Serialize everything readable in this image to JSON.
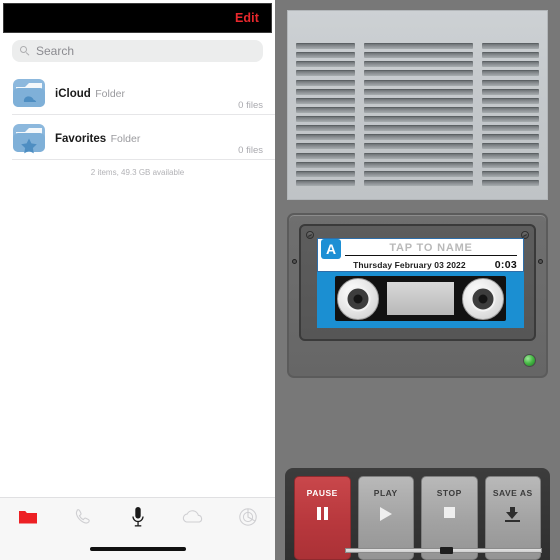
{
  "files_app": {
    "nav": {
      "edit_label": "Edit"
    },
    "search": {
      "placeholder": "Search",
      "icon": "search-icon"
    },
    "folders": [
      {
        "name": "iCloud",
        "type": "Folder",
        "count": "0 files",
        "icon": "cloud-folder-icon"
      },
      {
        "name": "Favorites",
        "type": "Folder",
        "count": "0 files",
        "icon": "star-folder-icon"
      }
    ],
    "status": "2 items, 49.3 GB available",
    "tabs": [
      {
        "name": "folder-tab",
        "icon": "folder-icon",
        "active": true,
        "color": "#ed2024"
      },
      {
        "name": "calls-tab",
        "icon": "phone-icon",
        "active": false,
        "color": "#d4d4d6"
      },
      {
        "name": "record-tab",
        "icon": "microphone-icon",
        "active": true,
        "color": "#1a1a1a"
      },
      {
        "name": "cloud-tab",
        "icon": "cloud-icon",
        "active": false,
        "color": "#d4d4d6"
      },
      {
        "name": "settings-tab",
        "icon": "gear-icon",
        "active": false,
        "color": "#d4d4d6"
      }
    ]
  },
  "recorder": {
    "speaker_grille": {
      "rows": 16,
      "columns": 3
    },
    "cassette": {
      "side_label": "A",
      "name_placeholder": "TAP TO NAME",
      "date": "Thursday February 03 2022",
      "duration": "0:03",
      "body_color": "#1b8fd2",
      "led_state": "on",
      "led_color": "#46b844"
    },
    "controls": [
      {
        "label": "PAUSE",
        "glyph": "pause-icon",
        "style": "red"
      },
      {
        "label": "PLAY",
        "glyph": "play-icon",
        "style": "grey"
      },
      {
        "label": "STOP",
        "glyph": "stop-icon",
        "style": "grey"
      },
      {
        "label": "SAVE AS",
        "glyph": "download-icon",
        "style": "grey"
      }
    ]
  }
}
